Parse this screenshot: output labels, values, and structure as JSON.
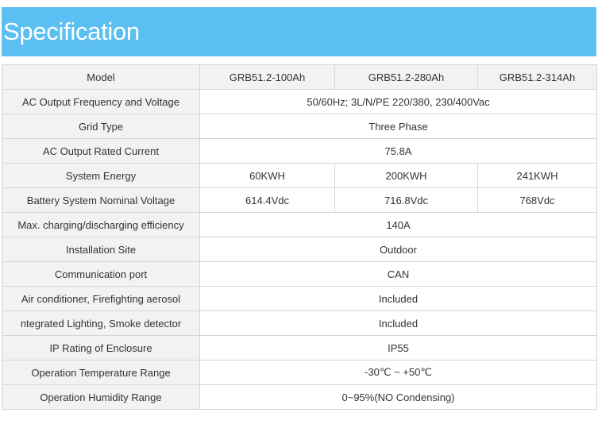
{
  "header": {
    "title": "Specification"
  },
  "table": {
    "models": [
      "GRB51.2-100Ah",
      "GRB51.2-280Ah",
      "GRB51.2-314Ah"
    ],
    "labels": {
      "model": "Model",
      "ac_freq_voltage": "AC Output Frequency and Voltage",
      "grid_type": "Grid Type",
      "ac_rated_current": "AC Output Rated Current",
      "system_energy": "System Energy",
      "battery_voltage": "Battery System Nominal Voltage",
      "efficiency": "Max. charging/discharging efficiency",
      "installation_site": "Installation Site",
      "comm_port": "Communication port",
      "air_conditioner": "Air conditioner, Firefighting aerosol",
      "lighting": "ntegrated Lighting, Smoke detector",
      "ip_rating": "IP Rating of Enclosure",
      "op_temp": "Operation Temperature Range",
      "op_humidity": "Operation Humidity Range"
    },
    "values": {
      "ac_freq_voltage": "50/60Hz; 3L/N/PE 220/380, 230/400Vac",
      "grid_type": "Three Phase",
      "ac_rated_current": "75.8A",
      "system_energy": [
        "60KWH",
        "200KWH",
        "241KWH"
      ],
      "battery_voltage": [
        "614.4Vdc",
        "716.8Vdc",
        "768Vdc"
      ],
      "efficiency": "140A",
      "installation_site": "Outdoor",
      "comm_port": "CAN",
      "air_conditioner": "Included",
      "lighting": "Included",
      "ip_rating": "IP55",
      "op_temp": "-30℃ ~ +50℃",
      "op_humidity": "0~95%(NO Condensing)"
    }
  }
}
